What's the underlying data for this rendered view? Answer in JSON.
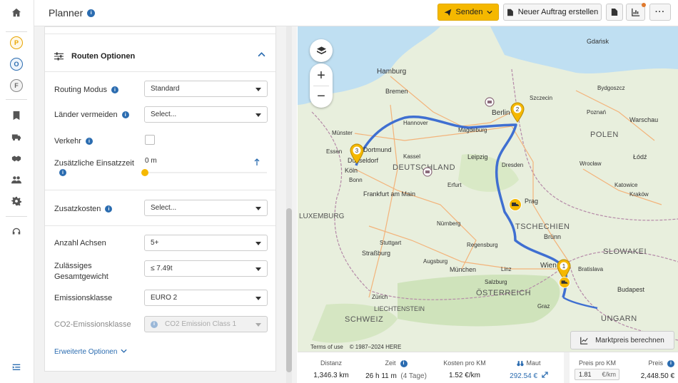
{
  "header": {
    "title": "Planner",
    "send_label": "Senden",
    "new_order_label": "Neuer Auftrag erstellen"
  },
  "nav": {
    "items": [
      {
        "id": "P",
        "color": "#e8a400"
      },
      {
        "id": "O",
        "color": "#2b6cb0"
      },
      {
        "id": "F",
        "color": "#666666"
      }
    ]
  },
  "panel": {
    "section_title": "Routen Optionen",
    "routing_mode": {
      "label": "Routing Modus",
      "value": "Standard"
    },
    "avoid_countries": {
      "label": "Länder vermeiden",
      "placeholder": "Select..."
    },
    "traffic": {
      "label": "Verkehr"
    },
    "extra_time": {
      "label": "Zusätzliche Einsatzzeit",
      "value": "0 m"
    },
    "extra_costs": {
      "label": "Zusatzkosten",
      "placeholder": "Select..."
    },
    "axles": {
      "label": "Anzahl Achsen",
      "value": "5+"
    },
    "total_weight": {
      "label_line1": "Zulässiges",
      "label_line2": "Gesamtgewicht",
      "value": "≤ 7.49t"
    },
    "emission_class": {
      "label": "Emissionsklasse",
      "value": "EURO 2"
    },
    "co2_class": {
      "label": "CO2-Emissionsklasse",
      "value": "CO2 Emission Class 1"
    },
    "advanced_link": "Erweiterte Optionen"
  },
  "map": {
    "labels": [
      {
        "t": "Hamburg"
      },
      {
        "t": "Bremen"
      },
      {
        "t": "Berlin"
      },
      {
        "t": "Hannover"
      },
      {
        "t": "Magdeburg"
      },
      {
        "t": "Leipzig"
      },
      {
        "t": "Dresden"
      },
      {
        "t": "DEUTSCHLAND"
      },
      {
        "t": "Düsseldorf"
      },
      {
        "t": "Köln"
      },
      {
        "t": "Dortmund"
      },
      {
        "t": "Frankfurt am Main"
      },
      {
        "t": "Nürnberg"
      },
      {
        "t": "München"
      },
      {
        "t": "Stuttgart"
      },
      {
        "t": "POLEN"
      },
      {
        "t": "Warschau"
      },
      {
        "t": "Poznań"
      },
      {
        "t": "Wrocław"
      },
      {
        "t": "Kraków"
      },
      {
        "t": "TSCHECHIEN"
      },
      {
        "t": "Prag"
      },
      {
        "t": "Brünn"
      },
      {
        "t": "Wien"
      },
      {
        "t": "Bratislava"
      },
      {
        "t": "Budapest"
      },
      {
        "t": "ÖSTERREICH"
      },
      {
        "t": "SLOWAKEI"
      },
      {
        "t": "UNGARN"
      },
      {
        "t": "SCHWEIZ"
      },
      {
        "t": "LIECHTENSTEIN"
      },
      {
        "t": "LUXEMBURG"
      },
      {
        "t": "Szczecin"
      },
      {
        "t": "Gdańsk"
      },
      {
        "t": "Bydgoszcz"
      },
      {
        "t": "Łódź"
      },
      {
        "t": "Katowice"
      },
      {
        "t": "Salzburg"
      },
      {
        "t": "Graz"
      },
      {
        "t": "Linz"
      },
      {
        "t": "Straßburg"
      },
      {
        "t": "Zürich"
      },
      {
        "t": "Bonn"
      },
      {
        "t": "Essen"
      },
      {
        "t": "Münster"
      },
      {
        "t": "Kassel"
      },
      {
        "t": "Erfurt"
      },
      {
        "t": "Augsburg"
      },
      {
        "t": "Regensburg"
      }
    ],
    "terms": "Terms of use",
    "copyright": "© 1987–2024 HERE",
    "market_price_button": "Marktpreis berechnen"
  },
  "stats": {
    "distance": {
      "label": "Distanz",
      "value": "1,346.3 km"
    },
    "time": {
      "label": "Zeit",
      "value": "26 h 11 m",
      "extra": "(4 Tage)"
    },
    "cost_per_km": {
      "label": "Kosten pro KM",
      "value": "1.52 €/km"
    },
    "toll": {
      "label": "Maut",
      "value": "292.54 €"
    },
    "price_per_km": {
      "label": "Preis pro KM",
      "value": "1.81",
      "unit": "€/km"
    },
    "price": {
      "label": "Preis",
      "value": "2,448.50 €"
    }
  }
}
